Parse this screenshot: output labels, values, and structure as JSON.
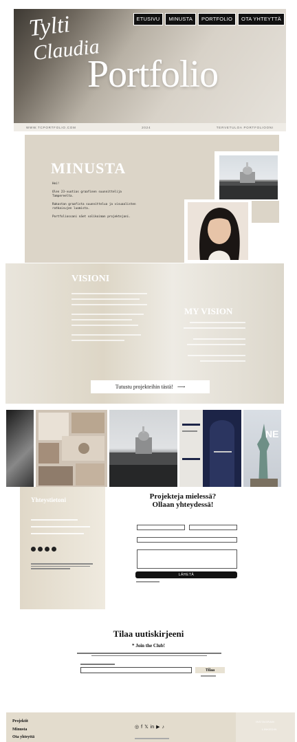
{
  "hero": {
    "nav": [
      "ETUSIVU",
      "MINUSTA",
      "PORTFOLIO",
      "OTA YHTEYTTÄ"
    ],
    "script_line1": "Tylti",
    "script_line2": "Claudia",
    "title": "Portfolio",
    "sub_left": "WWW.TCPORTFOLIO.COM",
    "sub_mid": "2024",
    "sub_right": "TERVETULOA PORTFOLIOONI"
  },
  "about": {
    "title": "MINUSTA",
    "paragraphs": [
      "Hei!",
      "Olen 23-vuotias graafinen suunnittelija Tampereelta.",
      "Rakastan graafista suunnittelua ja visuaalisten ratkaisujen luomista.",
      "Portfoliossani näet valikoiman projektejani."
    ]
  },
  "vision": {
    "title": "VISIONI",
    "my_title": "MY VISION",
    "cta_label": "Tutustu projekteihin tästä!",
    "cta_arrow": "⟶"
  },
  "contact": {
    "panel_title": "Yhteystietoni",
    "heading_line1": "Projekteja mielessä?",
    "heading_line2": "Ollaan yhteydessä!",
    "send_label": "LÄHETÄ"
  },
  "newsletter": {
    "title": "Tilaa uutiskirjeeni",
    "subtitle": "* Join the Club!",
    "button_label": "Tilaa"
  },
  "footer": {
    "links": [
      "Projektit",
      "Minusta",
      "Ota yhteyttä"
    ],
    "icons": [
      "instagram-icon",
      "facebook-icon",
      "twitter-icon",
      "linkedin-icon",
      "youtube-icon",
      "tiktok-icon"
    ],
    "icon_glyphs": [
      "◎",
      "f",
      "𝕏",
      "in",
      "▶",
      "♪"
    ],
    "right_links": [
      "INSTAGRAM",
      "LINKEDIN"
    ]
  },
  "colors": {
    "accent_beige": "#dcd5c8",
    "dark": "#111111",
    "footer_bg": "#e3dccd"
  }
}
